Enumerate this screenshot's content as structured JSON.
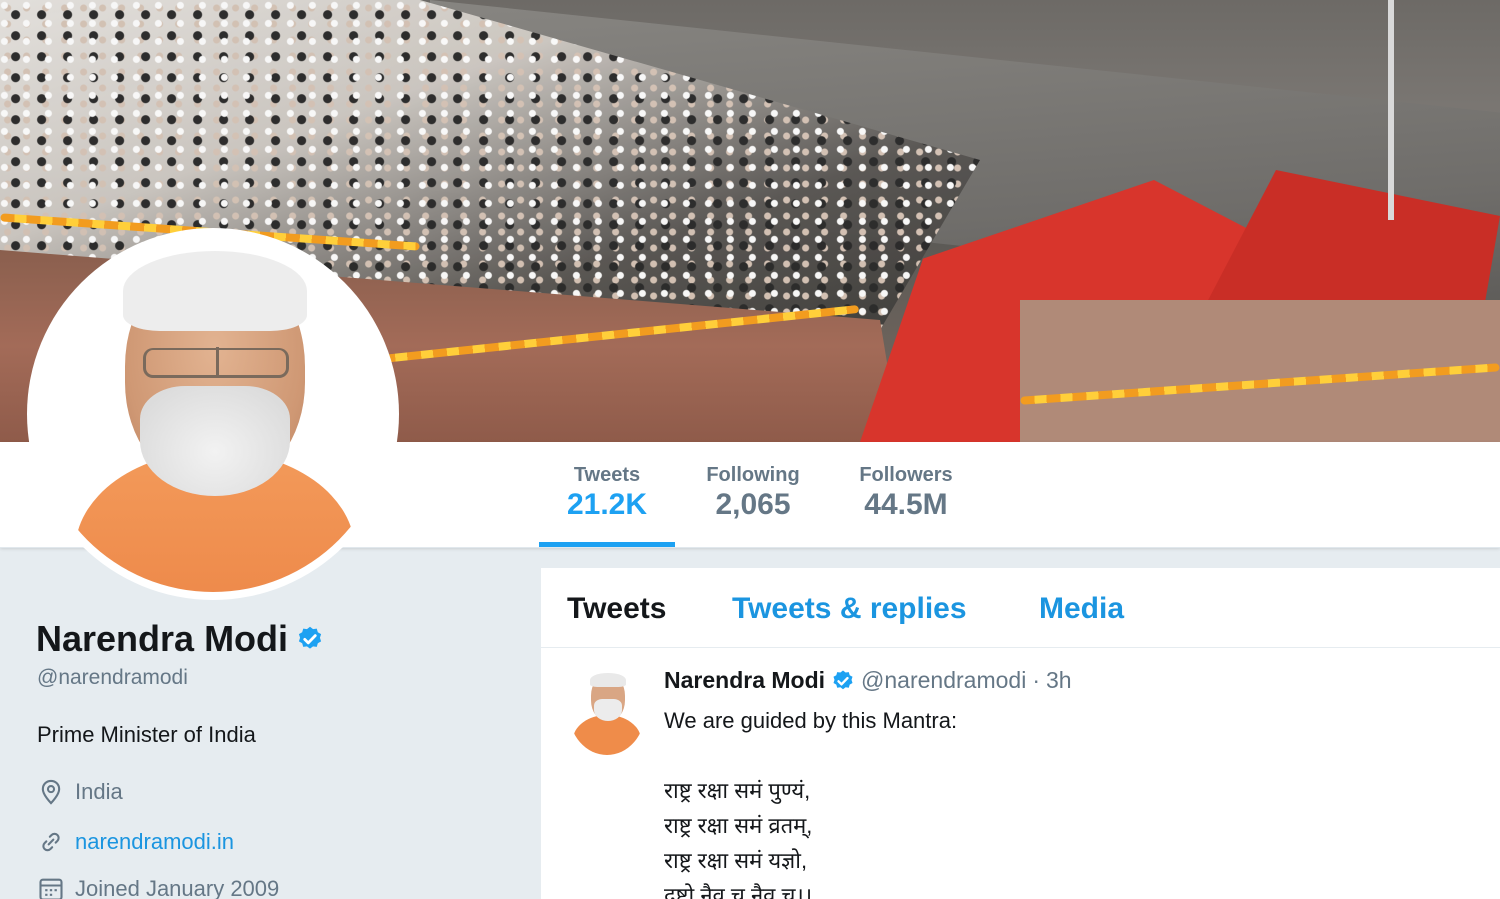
{
  "profile": {
    "name": "Narendra Modi",
    "handle": "@narendramodi",
    "bio": "Prime Minister of India",
    "location": "India",
    "website": "narendramodi.in",
    "joined": "Joined January 2009"
  },
  "stats": [
    {
      "label": "Tweets",
      "value": "21.2K"
    },
    {
      "label": "Following",
      "value": "2,065"
    },
    {
      "label": "Followers",
      "value": "44.5M"
    }
  ],
  "tabs": [
    {
      "label": "Tweets"
    },
    {
      "label": "Tweets & replies"
    },
    {
      "label": "Media"
    }
  ],
  "tweet": {
    "name": "Narendra Modi",
    "handle": "@narendramodi",
    "separator": "·",
    "time": "3h",
    "lines": [
      "We are guided by this Mantra:",
      "",
      "राष्ट्र रक्षा समं पुण्यं,",
      "राष्ट्र रक्षा समं व्रतम्,",
      "राष्ट्र रक्षा समं यज्ञो,",
      "दृष्टो नैव च नैव च।।"
    ]
  },
  "colors": {
    "accent": "#1da1f2",
    "link": "#1b95e0",
    "muted": "#657786",
    "text": "#14171a",
    "page_bg": "#e6ecf0"
  },
  "icons": {
    "verified": "verified-badge-icon",
    "location": "location-pin-icon",
    "link": "link-icon",
    "calendar": "calendar-icon"
  }
}
